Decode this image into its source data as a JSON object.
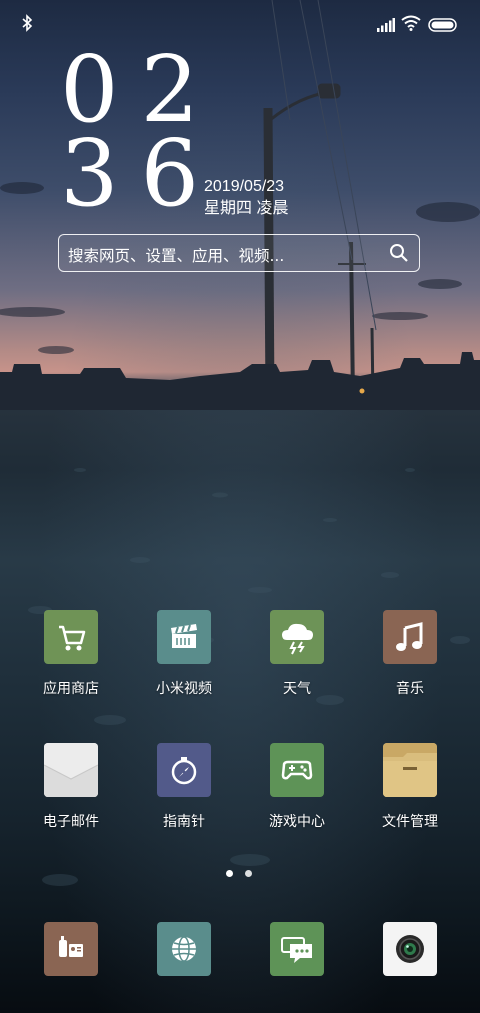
{
  "status_bar": {
    "left_icon": "bluetooth-icon",
    "right_icons": [
      "signal-icon",
      "wifi-icon",
      "battery-icon"
    ]
  },
  "clock": {
    "hours": "02",
    "minutes": "36"
  },
  "date": {
    "date_text": "2019/05/23",
    "weekday_text": "星期四 凌晨"
  },
  "search": {
    "placeholder": "搜索网页、设置、应用、视频...",
    "icon": "search-icon"
  },
  "apps": [
    {
      "label": "应用商店",
      "icon": "cart-icon",
      "color": "#6f9356"
    },
    {
      "label": "小米视频",
      "icon": "clapperboard-icon",
      "color": "#5a8d8c"
    },
    {
      "label": "天气",
      "icon": "storm-cloud-icon",
      "color": "#6d9357"
    },
    {
      "label": "音乐",
      "icon": "music-note-icon",
      "color": "#8a6553"
    },
    {
      "label": "电子邮件",
      "icon": "envelope-icon",
      "color": "#e8e8e8"
    },
    {
      "label": "指南针",
      "icon": "compass-icon",
      "color": "#525a8a"
    },
    {
      "label": "游戏中心",
      "icon": "gamepad-icon",
      "color": "#5e9357"
    },
    {
      "label": "文件管理",
      "icon": "folder-icon",
      "color": "#d1b26e"
    }
  ],
  "page_indicator": {
    "pages": 2,
    "current": 1
  },
  "dock": [
    {
      "icon": "phone-contacts-icon",
      "color": "#8a6553"
    },
    {
      "icon": "browser-globe-icon",
      "color": "#5a8d8c"
    },
    {
      "icon": "message-bubbles-icon",
      "color": "#5e9357"
    },
    {
      "icon": "camera-icon",
      "color": "#f4f4f4"
    }
  ]
}
